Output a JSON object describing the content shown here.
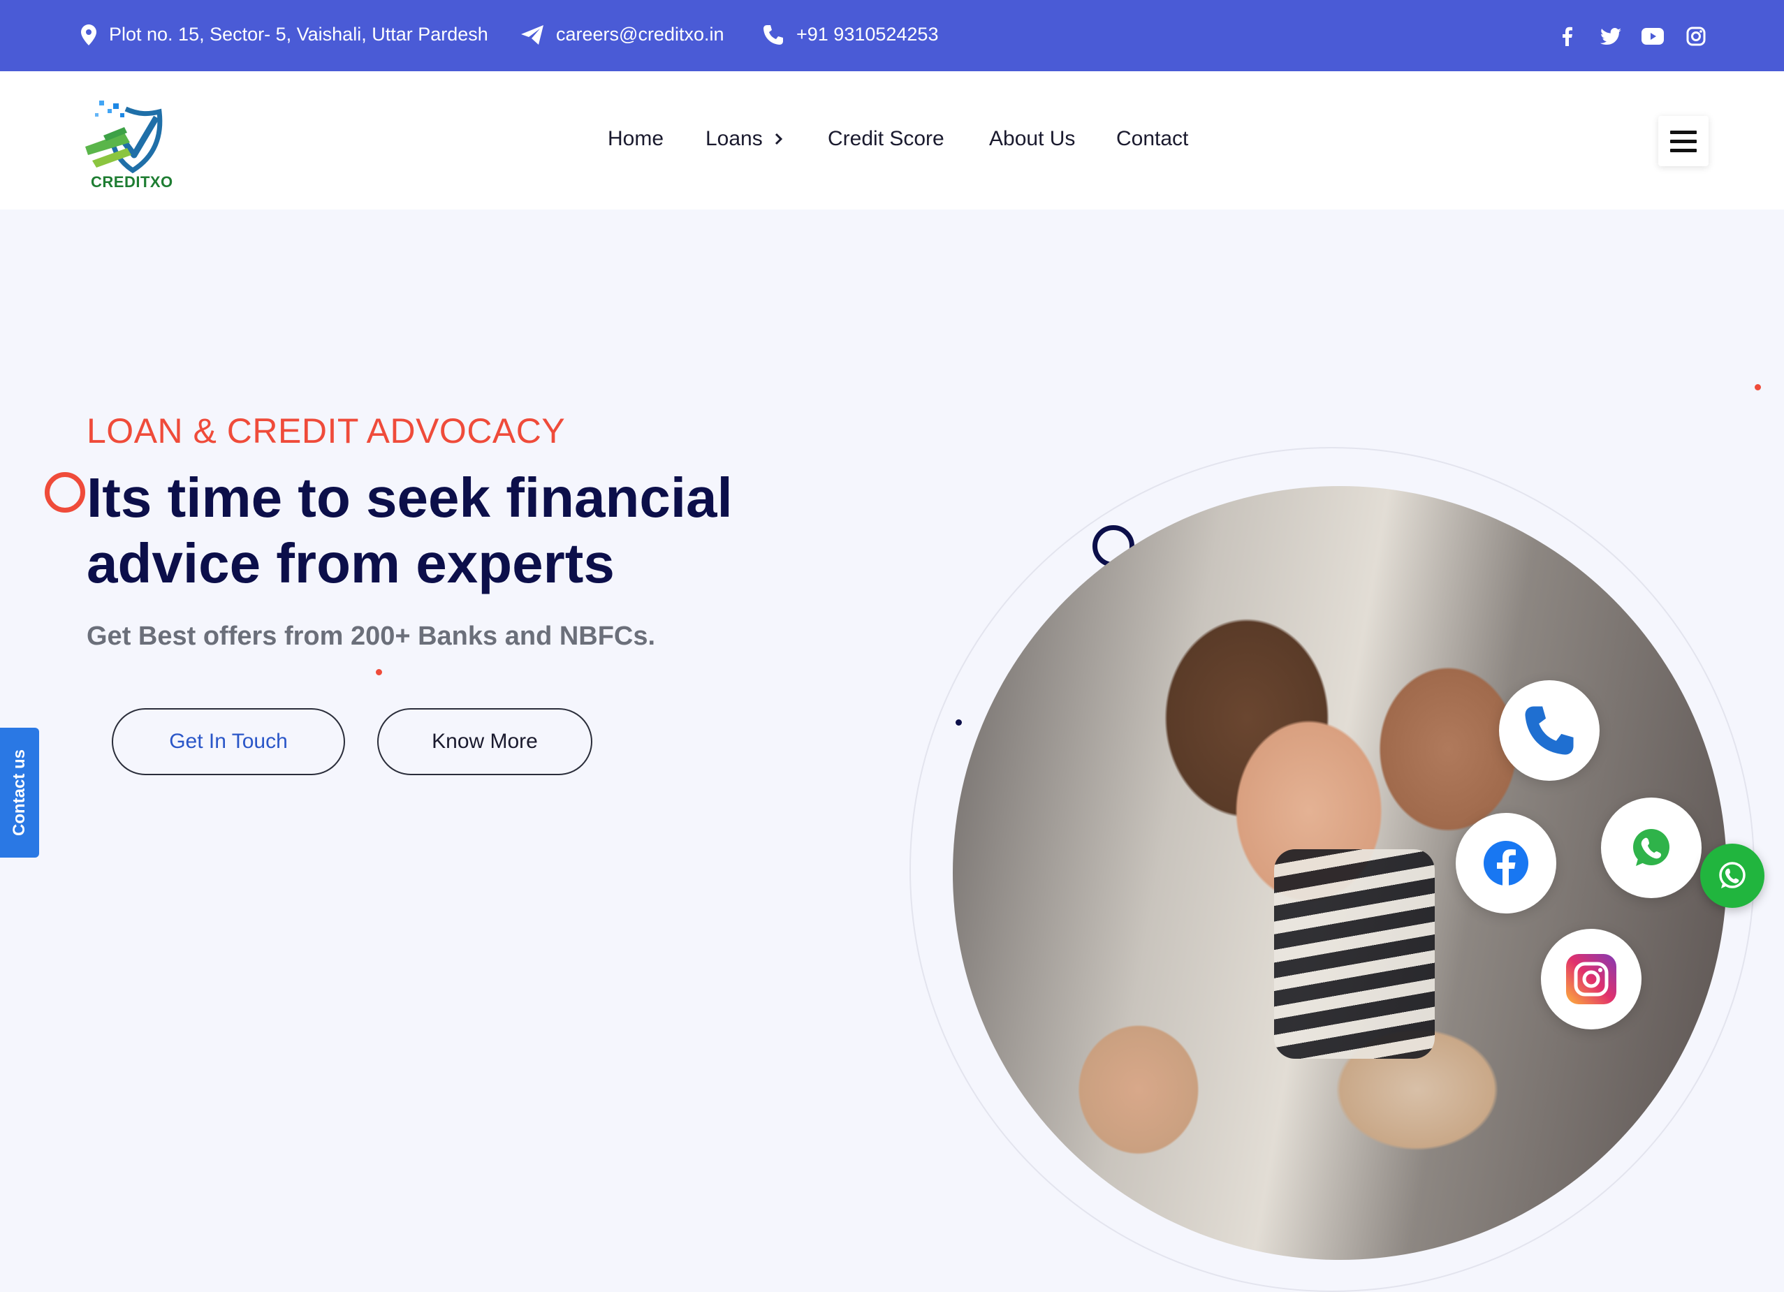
{
  "topbar": {
    "address": "Plot no. 15, Sector- 5, Vaishali, Uttar Pardesh",
    "email": "careers@creditxo.in",
    "phone": "+91 9310524253",
    "social": [
      "facebook-icon",
      "twitter-icon",
      "youtube-icon",
      "instagram-icon"
    ]
  },
  "brand": {
    "name": "CREDITXO"
  },
  "nav": {
    "items": [
      {
        "label": "Home"
      },
      {
        "label": "Loans",
        "has_submenu": true
      },
      {
        "label": "Credit Score"
      },
      {
        "label": "About Us"
      },
      {
        "label": "Contact"
      }
    ]
  },
  "hero": {
    "eyebrow": "LOAN & CREDIT ADVOCACY",
    "headline": "Its time to seek financial advice from experts",
    "subheadline": "Get Best offers from 200+ Banks and NBFCs.",
    "primary_button": "Get In Touch",
    "secondary_button": "Know More"
  },
  "contact_tab": {
    "label": "Contact us"
  },
  "floating_contacts": [
    "phone-icon",
    "whatsapp-icon",
    "facebook-icon",
    "instagram-icon"
  ],
  "colors": {
    "topbar": "#4a5bd6",
    "accent_red": "#ef4b3a",
    "heading_navy": "#0c0f4a",
    "contact_tab": "#2a78e4",
    "whatsapp": "#21b53e"
  }
}
